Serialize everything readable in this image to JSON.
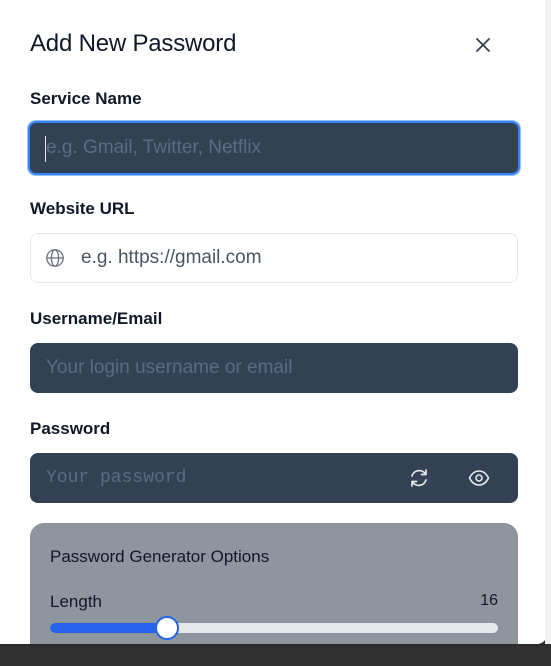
{
  "modal": {
    "title": "Add New Password",
    "close_icon": "close-icon"
  },
  "form": {
    "service_name": {
      "label": "Service Name",
      "placeholder": "e.g. Gmail, Twitter, Netflix",
      "value": ""
    },
    "website_url": {
      "label": "Website URL",
      "placeholder": "e.g. https://gmail.com",
      "value": "",
      "icon": "globe-icon"
    },
    "username": {
      "label": "Username/Email",
      "placeholder": "Your login username or email",
      "value": ""
    },
    "password": {
      "label": "Password",
      "placeholder": "Your password",
      "value": "",
      "regenerate_icon": "refresh-icon",
      "visibility_icon": "eye-icon"
    }
  },
  "generator": {
    "title": "Password Generator Options",
    "length_label": "Length",
    "length_value": "16",
    "length_min": 4,
    "length_max": 50
  },
  "colors": {
    "accent": "#2563eb",
    "field_dark": "#334155",
    "panel": "#8f959f"
  }
}
